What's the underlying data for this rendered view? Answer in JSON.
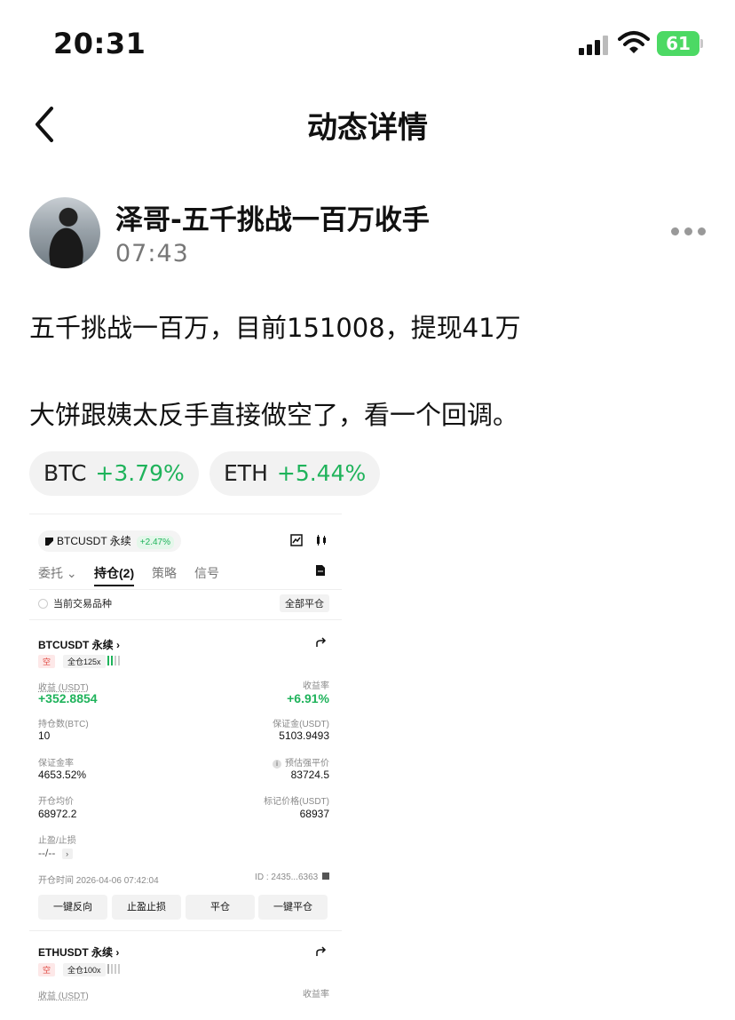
{
  "status_bar": {
    "time": "20:31",
    "battery": "61"
  },
  "nav": {
    "title": "动态详情"
  },
  "post": {
    "author": "泽哥-五千挑战一百万收手",
    "time": "07:43",
    "text_line1": "五千挑战一百万，目前151008，提现41万",
    "text_line2": "大饼跟姨太反手直接做空了，看一个回调。",
    "tags": [
      {
        "symbol": "BTC",
        "change": "+3.79%"
      },
      {
        "symbol": "ETH",
        "change": "+5.44%"
      }
    ]
  },
  "screenshot": {
    "pair": "BTCUSDT 永续",
    "pair_change": "+2.47%",
    "tabs": [
      "委托",
      "持仓(2)",
      "策略",
      "信号"
    ],
    "filter_label": "当前交易品种",
    "close_all": "全部平仓",
    "positions": [
      {
        "title": "BTCUSDT 永续",
        "side": "空",
        "leverage": "全仓125x",
        "pnl_label": "收益 (USDT)",
        "pnl": "+352.8854",
        "roe_label": "收益率",
        "roe": "+6.91%",
        "size_label": "持仓数(BTC)",
        "size": "10",
        "margin_label": "保证金(USDT)",
        "margin": "5103.9493",
        "margin_ratio_label": "保证金率",
        "margin_ratio": "4653.52%",
        "liq_label": "预估强平价",
        "liq": "83724.5",
        "entry_label": "开仓均价",
        "entry": "68972.2",
        "mark_label": "标记价格(USDT)",
        "mark": "68937",
        "tpsl_label": "止盈/止损",
        "tpsl": "--/--",
        "open_time": "开仓时间 2026-04-06 07:42:04",
        "id": "ID : 2435...6363"
      },
      {
        "title": "ETHUSDT 永续",
        "side": "空",
        "leverage": "全仓100x",
        "pnl_label": "收益 (USDT)",
        "roe_label": "收益率"
      }
    ],
    "buttons": [
      "一键反向",
      "止盈止损",
      "平仓",
      "一键平仓"
    ]
  }
}
